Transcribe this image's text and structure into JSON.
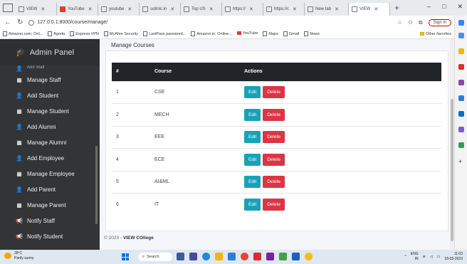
{
  "browser": {
    "tabs": [
      {
        "label": "VIEW",
        "icon": "page-icon",
        "active": false
      },
      {
        "label": "YouTube",
        "icon": "youtube-icon",
        "active": false
      },
      {
        "label": "youtube",
        "icon": "search-icon",
        "active": false
      },
      {
        "label": "sotinic.in",
        "icon": "search-icon",
        "active": false
      },
      {
        "label": "Top US",
        "icon": "page-icon",
        "active": false
      },
      {
        "label": "https://",
        "icon": "page-icon",
        "active": false
      },
      {
        "label": "https://c",
        "icon": "page-icon",
        "active": false
      },
      {
        "label": "New tab",
        "icon": "newtab-icon",
        "active": false
      },
      {
        "label": "VIEW",
        "icon": "page-icon",
        "active": true
      }
    ],
    "url": "127.0.0.1:8000/course/manage/",
    "signin_label": "Sign in",
    "bookmarks": [
      {
        "label": "Amazon.com. Onl...",
        "icon": "page-icon"
      },
      {
        "label": "Agoda",
        "icon": "page-icon"
      },
      {
        "label": "Express VPN",
        "icon": "page-icon"
      },
      {
        "label": "McAfee Security",
        "icon": "page-icon"
      },
      {
        "label": "LastPass password...",
        "icon": "page-icon"
      },
      {
        "label": "Amazon.in: Online...",
        "icon": "page-icon"
      },
      {
        "label": "YouTube",
        "icon": "youtube-icon"
      },
      {
        "label": "Maps",
        "icon": "maps-icon"
      },
      {
        "label": "Gmail",
        "icon": "gmail-icon"
      },
      {
        "label": "News",
        "icon": "news-icon"
      }
    ],
    "other_favorites": "Other favorites"
  },
  "sidebar": {
    "brand": "Admin Panel",
    "cut_item": "Add Staff",
    "items": [
      {
        "label": "Manage Staff",
        "icon": "table-icon"
      },
      {
        "label": "Add Student",
        "icon": "user-plus-icon"
      },
      {
        "label": "Manage Student",
        "icon": "table-icon"
      },
      {
        "label": "Add Alumni",
        "icon": "user-plus-icon"
      },
      {
        "label": "Manage Alumni",
        "icon": "table-icon"
      },
      {
        "label": "Add Employee",
        "icon": "user-plus-icon"
      },
      {
        "label": "Manage Employee",
        "icon": "table-icon"
      },
      {
        "label": "Add Parent",
        "icon": "user-plus-icon"
      },
      {
        "label": "Manage Parent",
        "icon": "table-icon"
      },
      {
        "label": "Notify Staff",
        "icon": "megaphone-icon"
      },
      {
        "label": "Notify Student",
        "icon": "megaphone-icon"
      }
    ]
  },
  "main": {
    "title": "Manage Courses",
    "table": {
      "headers": [
        "#",
        "Course",
        "Actions"
      ],
      "rows": [
        {
          "num": "1",
          "course": "CSE"
        },
        {
          "num": "2",
          "course": "MECH"
        },
        {
          "num": "3",
          "course": "EEE"
        },
        {
          "num": "4",
          "course": "ECE"
        },
        {
          "num": "5",
          "course": "AI&ML"
        },
        {
          "num": "6",
          "course": "IT"
        }
      ],
      "edit_label": "Edit",
      "delete_label": "Delete"
    },
    "footer_prefix": "© 2023 - ",
    "footer_brand": "VIEW COllege"
  },
  "taskbar": {
    "weather_temp": "28°C",
    "weather_desc": "Partly sunny",
    "search_label": "Search",
    "lang": "ENG",
    "lang_sub": "IN",
    "time": "11:03",
    "date": "18-03-2023"
  },
  "colors": {
    "sidebar_bg": "#333435",
    "header_bg": "#212529",
    "edit_btn": "#17a2b8",
    "delete_btn": "#dc3545"
  }
}
